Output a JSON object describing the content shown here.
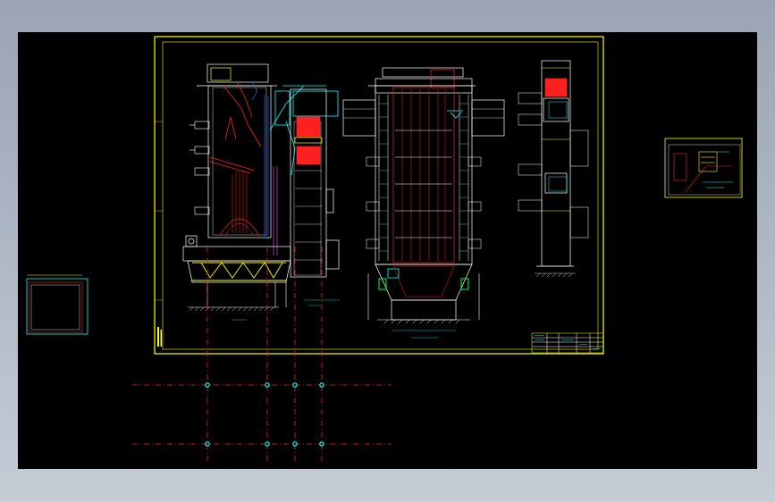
{
  "window": {
    "background_top": "#9aa4b4",
    "background_bottom": "#c5ccd6",
    "viewport_color": "#000000"
  },
  "colors": {
    "frame": "#ffff00",
    "line_white": "#ffffff",
    "line_red": "#ff2020",
    "line_cyan": "#00ffff",
    "line_blue": "#3060ff",
    "line_magenta": "#ff40ff",
    "line_green": "#00ff40",
    "line_yellow": "#ffff00",
    "axis_dash": "#ff2020"
  },
  "drawing": {
    "views": [
      "boiler-side-section",
      "boiler-front-section",
      "boiler-rear-view",
      "detail-view-right",
      "detail-view-left"
    ],
    "icons": [
      "grid-node-icon"
    ]
  }
}
